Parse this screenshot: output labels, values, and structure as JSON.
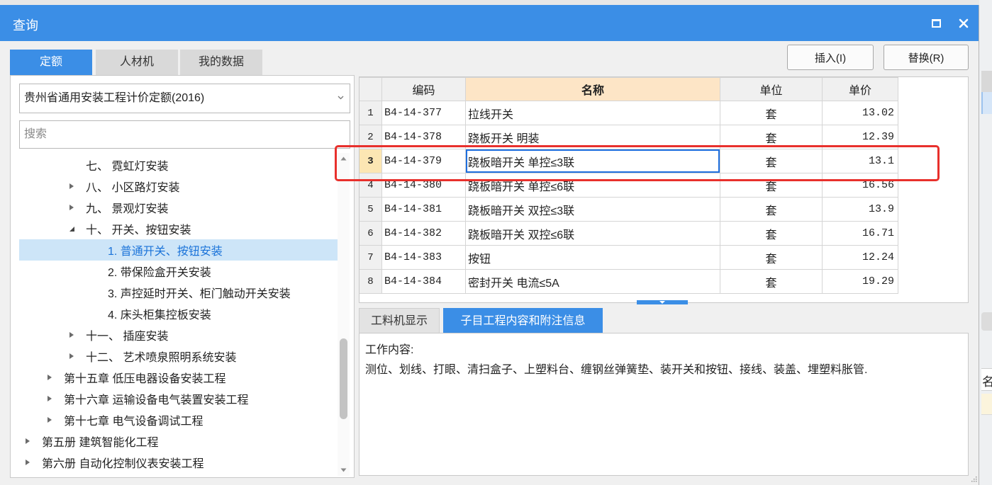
{
  "window": {
    "title": "查询"
  },
  "colors": {
    "accent": "#3b8ee6",
    "highlight_box": "#e8302c",
    "tree_selected_bg": "#cde5f8",
    "tree_selected_text": "#1a73d9",
    "header_highlight_bg": "#fde5c6",
    "cell_focus": "#1f6fde"
  },
  "icons": {
    "maximize": "maximize-icon",
    "close": "close-icon",
    "dropdown": "chevron-down-icon",
    "collapsed": "caret-right-icon",
    "expanded": "caret-expanded-icon",
    "scroll_up": "scroll-up-icon",
    "scroll_down": "scroll-down-icon",
    "splitter": "triangle-down-icon"
  },
  "tabs": [
    {
      "label": "定额",
      "active": true
    },
    {
      "label": "人材机",
      "active": false
    },
    {
      "label": "我的数据",
      "active": false
    }
  ],
  "actions": {
    "insert": "插入(I)",
    "replace": "替换(R)"
  },
  "left": {
    "library_select": "贵州省通用安装工程计价定额(2016)",
    "search_placeholder": "搜索",
    "tree": [
      {
        "label": "七、 霓虹灯安装",
        "level": 2,
        "expandable": false,
        "expanded": false,
        "selected": false
      },
      {
        "label": "八、 小区路灯安装",
        "level": 2,
        "expandable": true,
        "expanded": false,
        "selected": false
      },
      {
        "label": "九、 景观灯安装",
        "level": 2,
        "expandable": true,
        "expanded": false,
        "selected": false
      },
      {
        "label": "十、 开关、按钮安装",
        "level": 2,
        "expandable": true,
        "expanded": true,
        "selected": false
      },
      {
        "label": "1. 普通开关、按钮安装",
        "level": 3,
        "expandable": false,
        "expanded": false,
        "selected": true
      },
      {
        "label": "2. 带保险盒开关安装",
        "level": 3,
        "expandable": false,
        "expanded": false,
        "selected": false
      },
      {
        "label": "3. 声控延时开关、柜门触动开关安装",
        "level": 3,
        "expandable": false,
        "expanded": false,
        "selected": false
      },
      {
        "label": "4. 床头柜集控板安装",
        "level": 3,
        "expandable": false,
        "expanded": false,
        "selected": false
      },
      {
        "label": "十一、 插座安装",
        "level": 2,
        "expandable": true,
        "expanded": false,
        "selected": false
      },
      {
        "label": "十二、 艺术喷泉照明系统安装",
        "level": 2,
        "expandable": true,
        "expanded": false,
        "selected": false
      },
      {
        "label": "第十五章 低压电器设备安装工程",
        "level": 1,
        "expandable": true,
        "expanded": false,
        "selected": false
      },
      {
        "label": "第十六章 运输设备电气装置安装工程",
        "level": 1,
        "expandable": true,
        "expanded": false,
        "selected": false
      },
      {
        "label": "第十七章 电气设备调试工程",
        "level": 1,
        "expandable": true,
        "expanded": false,
        "selected": false
      },
      {
        "label": "第五册 建筑智能化工程",
        "level": 0,
        "expandable": true,
        "expanded": false,
        "selected": false
      },
      {
        "label": "第六册 自动化控制仪表安装工程",
        "level": 0,
        "expandable": true,
        "expanded": false,
        "selected": false
      }
    ]
  },
  "table": {
    "columns": [
      "编码",
      "名称",
      "单位",
      "单价"
    ],
    "highlighted_column_index": 1,
    "rows": [
      {
        "no": "1",
        "code": "B4-14-377",
        "name": "拉线开关",
        "unit": "套",
        "price": "13.02",
        "selected": false
      },
      {
        "no": "2",
        "code": "B4-14-378",
        "name": "跷板开关 明装",
        "unit": "套",
        "price": "12.39",
        "selected": false
      },
      {
        "no": "3",
        "code": "B4-14-379",
        "name": "跷板暗开关 单控≤3联",
        "unit": "套",
        "price": "13.1",
        "selected": true
      },
      {
        "no": "4",
        "code": "B4-14-380",
        "name": "跷板暗开关 单控≤6联",
        "unit": "套",
        "price": "16.56",
        "selected": false
      },
      {
        "no": "5",
        "code": "B4-14-381",
        "name": "跷板暗开关 双控≤3联",
        "unit": "套",
        "price": "13.9",
        "selected": false
      },
      {
        "no": "6",
        "code": "B4-14-382",
        "name": "跷板暗开关 双控≤6联",
        "unit": "套",
        "price": "16.71",
        "selected": false
      },
      {
        "no": "7",
        "code": "B4-14-383",
        "name": "按钮",
        "unit": "套",
        "price": "12.24",
        "selected": false
      },
      {
        "no": "8",
        "code": "B4-14-384",
        "name": "密封开关 电流≤5A",
        "unit": "套",
        "price": "19.29",
        "selected": false
      }
    ]
  },
  "detail": {
    "tabs": [
      {
        "label": "工料机显示",
        "active": false
      },
      {
        "label": "子目工程内容和附注信息",
        "active": true
      }
    ],
    "heading": "工作内容:",
    "content": "测位、划线、打眼、清扫盒子、上塑料台、缠钢丝弹簧垫、装开关和按钮、接线、装盖、埋塑料胀管."
  },
  "background_app": {
    "partial_label": "名"
  }
}
